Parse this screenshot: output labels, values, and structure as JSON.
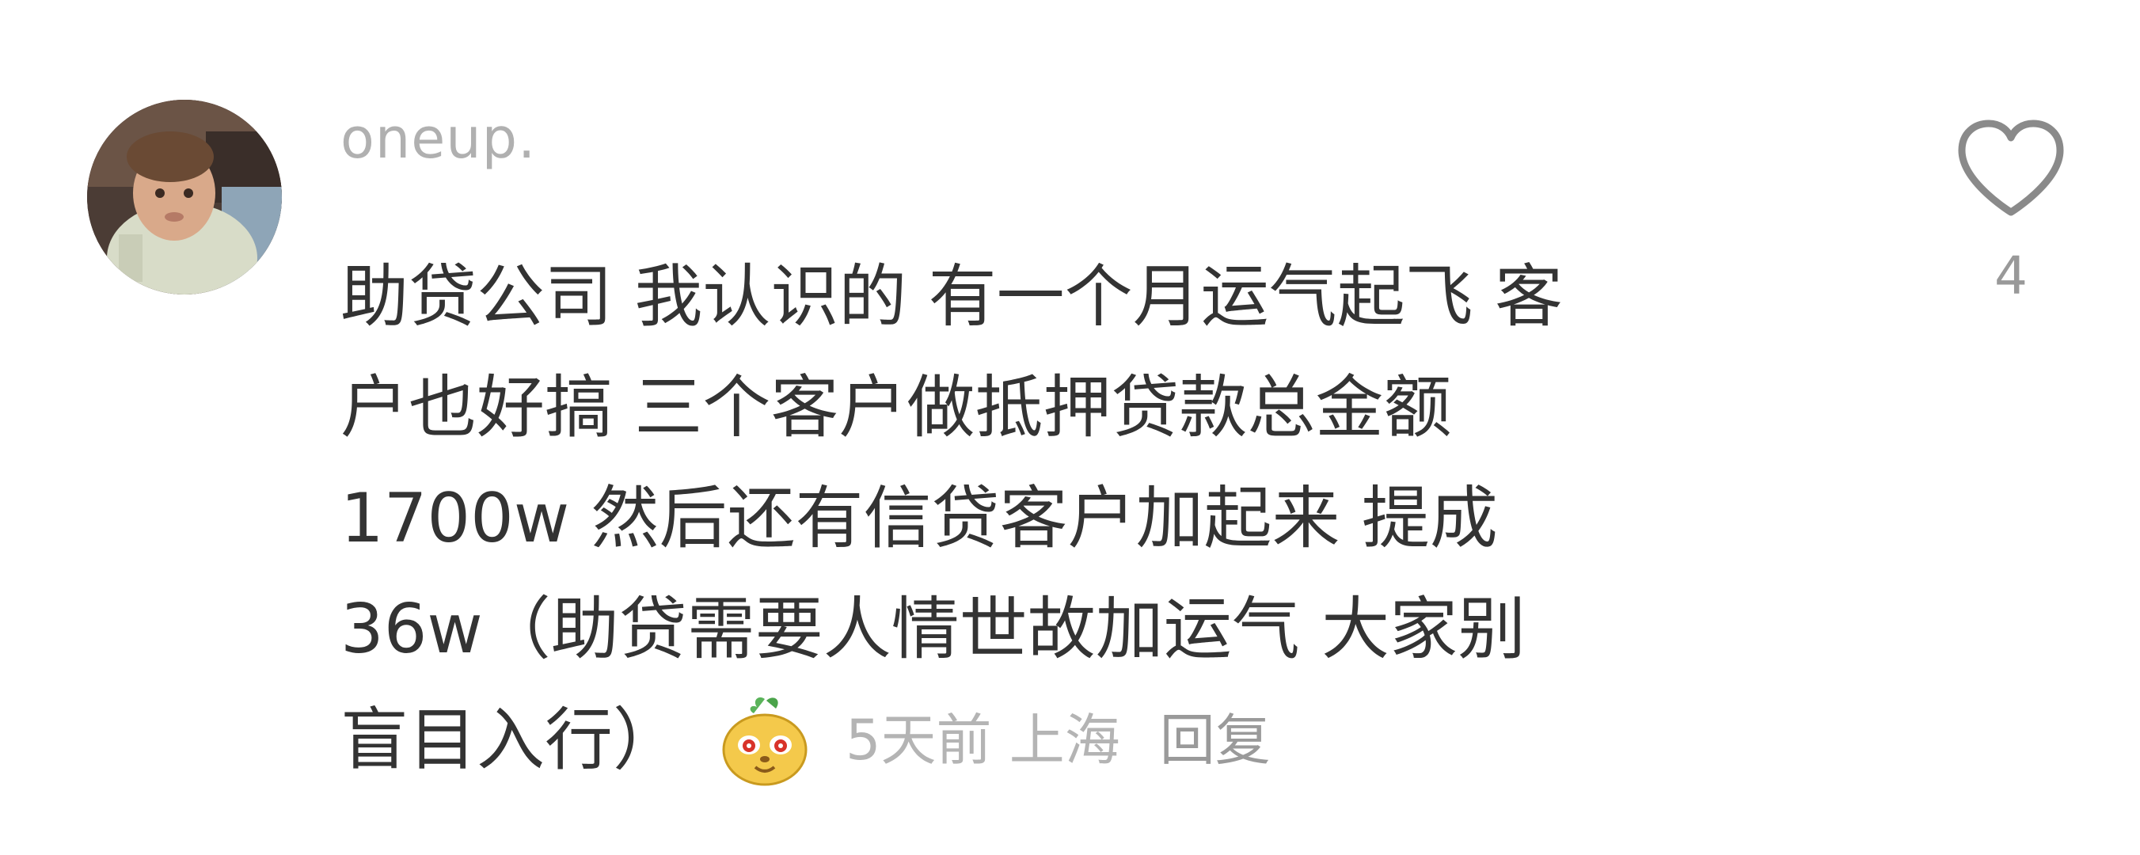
{
  "comment": {
    "avatar_icon": "user-avatar-photo",
    "username": "oneup.",
    "text_lines": [
      "助贷公司 我认识的 有一个月运气起飞 客",
      "户也好搞 三个客户做抵押贷款总金额",
      "1700w 然后还有信贷客户加起来 提成",
      "36w（助贷需要人情世故加运气 大家别",
      "盲目入行）"
    ],
    "emoji_icon": "cartoon-face-emoji-icon",
    "time_location": "5天前 上海",
    "reply_label": "回复",
    "like_icon": "heart-outline-icon",
    "like_count": "4"
  },
  "colors": {
    "background": "#ffffff",
    "text": "#333333",
    "username": "#b0b0b0",
    "meta": "#b4b4b4",
    "like_icon": "#8a8a8a"
  }
}
